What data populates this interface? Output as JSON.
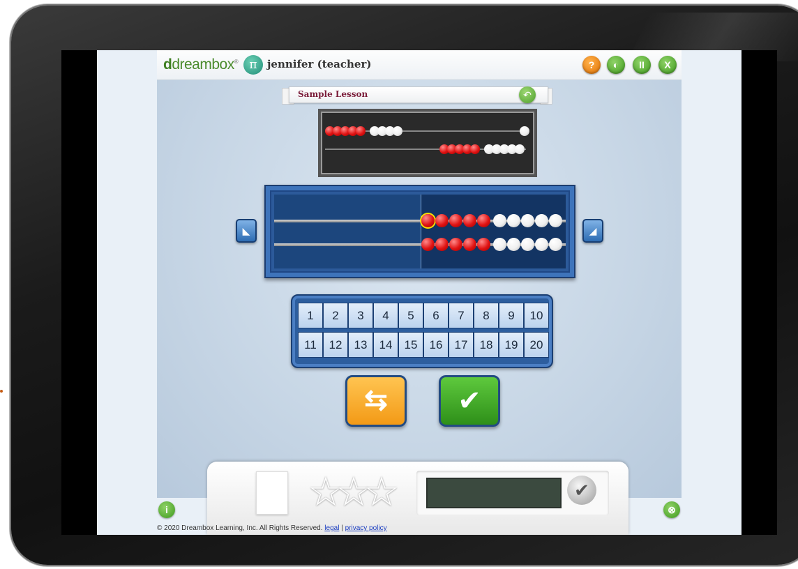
{
  "header": {
    "brand_d": "d",
    "brand_name": "dreambox",
    "brand_mark": "®",
    "pi_symbol": "π",
    "user": "jennifer (teacher)",
    "help_label": "?",
    "sound_label": "◐",
    "pause_label": "II",
    "exit_label": "X"
  },
  "lesson": {
    "title": "Sample Lesson",
    "back_glyph": "↶"
  },
  "numpad": {
    "row1": [
      "1",
      "2",
      "3",
      "4",
      "5",
      "6",
      "7",
      "8",
      "9",
      "10"
    ],
    "row2": [
      "11",
      "12",
      "13",
      "14",
      "15",
      "16",
      "17",
      "18",
      "19",
      "20"
    ]
  },
  "buttons": {
    "reset_glyph": "⇆",
    "check_glyph": "✔",
    "left_arrow": "◣",
    "right_arrow": "◢"
  },
  "score": {
    "stars": [
      "☆",
      "☆",
      "☆"
    ],
    "check_glyph": "✔"
  },
  "corners": {
    "info_label": "i",
    "close_label": "⊗"
  },
  "footer": {
    "copyright": "© 2020 Dreambox Learning, Inc. All Rights Reserved.",
    "legal": "legal",
    "separator": "|",
    "privacy": "privacy policy"
  },
  "colors": {
    "brand_green": "#4a8b2c",
    "bead_red": "#e01313",
    "bead_white": "#ffffff",
    "rack_blue": "#2c5a9a",
    "reset_orange": "#f39a16",
    "check_green": "#2e8f19"
  }
}
